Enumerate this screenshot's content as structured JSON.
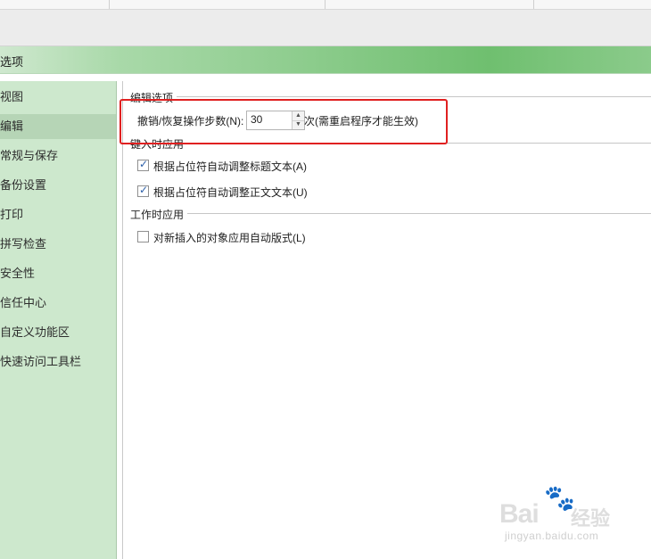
{
  "window": {
    "title": "选项"
  },
  "sidebar": {
    "items": [
      {
        "label": "视图"
      },
      {
        "label": "编辑"
      },
      {
        "label": "常规与保存"
      },
      {
        "label": "备份设置"
      },
      {
        "label": "打印"
      },
      {
        "label": "拼写检查"
      },
      {
        "label": "安全性"
      },
      {
        "label": "信任中心"
      },
      {
        "label": "自定义功能区"
      },
      {
        "label": "快速访问工具栏"
      }
    ],
    "active": "编辑"
  },
  "main": {
    "section1": {
      "title": "编辑选项",
      "undo_label": "撤销/恢复操作步数(N):",
      "undo_value": "30",
      "undo_suffix": "次(需重启程序才能生效)"
    },
    "section2": {
      "title": "键入时应用",
      "options": [
        {
          "label": "根据占位符自动调整标题文本(A)",
          "checked": true
        },
        {
          "label": "根据占位符自动调整正文文本(U)",
          "checked": true
        }
      ]
    },
    "section3": {
      "title": "工作时应用",
      "options": [
        {
          "label": "对新插入的对象应用自动版式(L)",
          "checked": false
        }
      ]
    }
  },
  "watermark": {
    "brand": "Bai",
    "brand_cn": "经验",
    "url": "jingyan.baidu.com"
  },
  "colors": {
    "titlebar_green": "#8fcd8f",
    "sidebar_bg": "#cde8cd",
    "highlight_red": "#e02020",
    "check_blue": "#2a5ea8"
  }
}
